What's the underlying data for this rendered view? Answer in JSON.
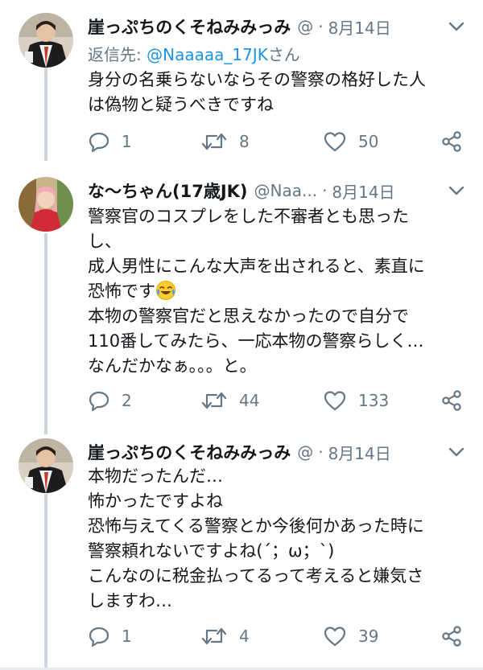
{
  "tweets": [
    {
      "name": "崖っぷちのくそねみみっみ",
      "handle": "@",
      "separator": "·",
      "date": "8月14日",
      "reply_prefix": "返信先: ",
      "reply_mention": "@Naaaaa_17JK",
      "reply_suffix": "さん",
      "lines": [
        "身分の名乗らないならその警察の格好した人",
        "は偽物と疑うべきですね"
      ],
      "replies": "1",
      "retweets": "8",
      "likes": "50"
    },
    {
      "name": "な〜ちゃん(17歳JK)",
      "handle": "@Naa...",
      "separator": "·",
      "date": "8月14日",
      "lines": [
        "警察官のコスプレをした不審者とも思った",
        "し、",
        "成人男性にこんな大声を出されると、素直に",
        "恐怖です",
        "本物の警察官だと思えなかったので自分で",
        "110番してみたら、一応本物の警察らしく…",
        "なんだかなぁ。。。と。"
      ],
      "emoji_icon": "face-with-tears-of-joy-emoji",
      "replies": "2",
      "retweets": "44",
      "likes": "133"
    },
    {
      "name": "崖っぷちのくそねみみっみ",
      "handle": "@",
      "separator": "·",
      "date": "8月14日",
      "lines": [
        "本物だったんだ…",
        "怖かったですよね",
        "恐怖与えてくる警察とか今後何かあった時に",
        "警察頼れないですよね(´；ω；`)",
        "こんなのに税金払ってるって考えると嫌気さ",
        "しますわ…"
      ],
      "replies": "1",
      "retweets": "4",
      "likes": "39"
    }
  ],
  "icons": [
    "reply-icon",
    "retweet-icon",
    "like-icon",
    "share-icon",
    "chevron-down-icon"
  ],
  "colors": {
    "secondary_text": "#657786",
    "link": "#1b95e0",
    "thread_line": "#ccd6dd"
  }
}
